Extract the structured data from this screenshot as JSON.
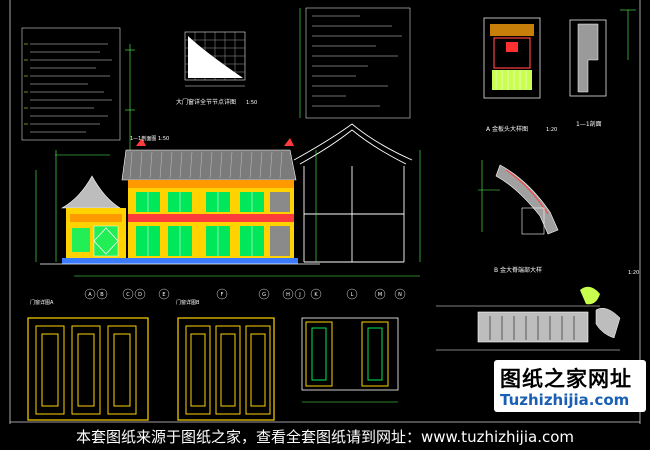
{
  "drawing": {
    "labels": {
      "panel_title": "大门窗详全节节点详图",
      "section_1": "1—1剖面",
      "detail_a": "A 金板头大样图",
      "detail_b": "B 金大脊端部大样",
      "scale_a": "1:20",
      "scale_b": "1:20",
      "scale_main": "1:50",
      "elevation_note": "1—1剖面图 1:50",
      "door_a": "门窗详图A",
      "door_b": "门窗详图B"
    },
    "axis_labels": [
      "A",
      "B",
      "C",
      "D",
      "E",
      "F",
      "G",
      "H",
      "J",
      "K",
      "L",
      "M",
      "N"
    ]
  },
  "watermark": {
    "line1": "图纸之家网址",
    "line2": "Tuzhizhijia.com"
  },
  "footer": {
    "text": "本套图纸来源于图纸之家，查看全套图纸请到网址：www.tuzhizhijia.com"
  }
}
